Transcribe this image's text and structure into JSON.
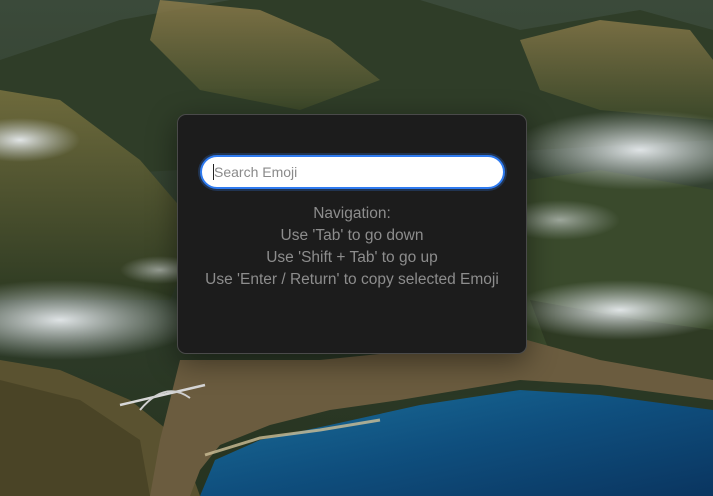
{
  "wallpaper": {
    "description_icon": "landscape-wallpaper"
  },
  "emoji_picker": {
    "search": {
      "placeholder": "Search Emoji",
      "value": ""
    },
    "help": {
      "heading": "Navigation:",
      "lines": [
        "Use 'Tab' to go down",
        "Use 'Shift + Tab' to go up",
        "Use 'Enter / Return' to copy selected Emoji"
      ]
    }
  },
  "colors": {
    "accent": "#2f7bf0",
    "panel_bg": "#1c1c1c",
    "help_text": "#8d8d8d"
  }
}
